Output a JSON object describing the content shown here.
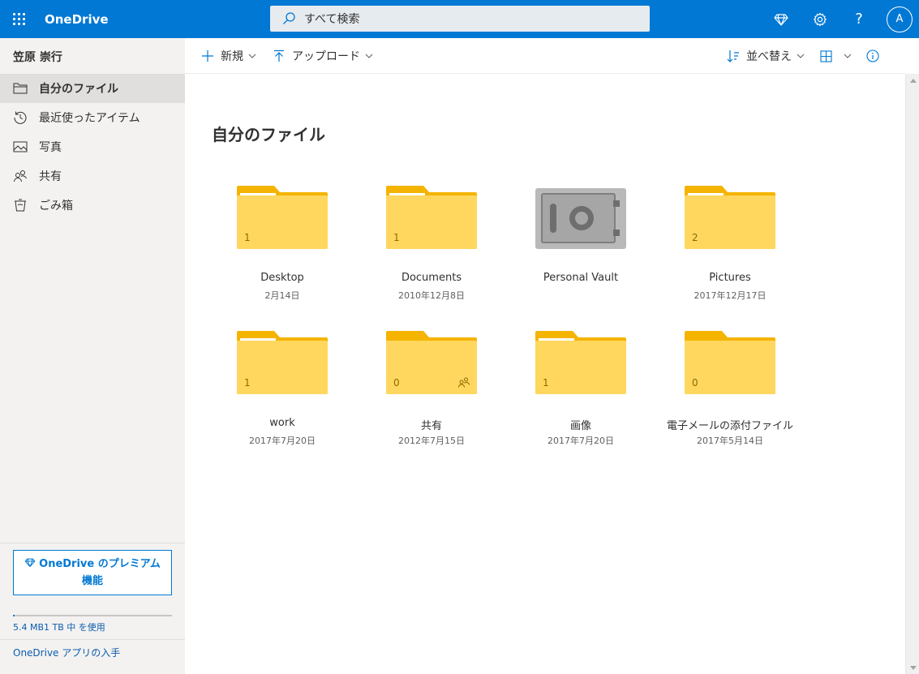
{
  "app": {
    "name": "OneDrive"
  },
  "search": {
    "placeholder": "すべて検索"
  },
  "user": {
    "name": "笠原 崇行",
    "initial": "A"
  },
  "sidebar": {
    "items": [
      {
        "label": "自分のファイル",
        "icon": "folder-icon",
        "active": true
      },
      {
        "label": "最近使ったアイテム",
        "icon": "history-icon",
        "active": false
      },
      {
        "label": "写真",
        "icon": "photo-icon",
        "active": false
      },
      {
        "label": "共有",
        "icon": "people-icon",
        "active": false
      },
      {
        "label": "ごみ箱",
        "icon": "trash-icon",
        "active": false
      }
    ],
    "premium_label": "OneDrive のプレミアム機能",
    "storage_text": "5.4 MB1 TB 中 を使用",
    "get_app": "OneDrive アプリの入手"
  },
  "commands": {
    "new_label": "新規",
    "upload_label": "アップロード",
    "sort_label": "並べ替え"
  },
  "main": {
    "title": "自分のファイル",
    "items": [
      {
        "name": "Desktop",
        "date": "2月14日",
        "count": "1",
        "type": "folder"
      },
      {
        "name": "Documents",
        "date": "2010年12月8日",
        "count": "1",
        "type": "folder"
      },
      {
        "name": "Personal Vault",
        "date": "",
        "count": "",
        "type": "vault"
      },
      {
        "name": "Pictures",
        "date": "2017年12月17日",
        "count": "2",
        "type": "folder"
      },
      {
        "name": "work",
        "date": "2017年7月20日",
        "count": "1",
        "type": "folder"
      },
      {
        "name": "共有",
        "date": "2012年7月15日",
        "count": "0",
        "type": "shared-folder"
      },
      {
        "name": "画像",
        "date": "2017年7月20日",
        "count": "1",
        "type": "folder"
      },
      {
        "name": "電子メールの添付ファイル",
        "date": "2017年5月14日",
        "count": "0",
        "type": "folder"
      }
    ]
  },
  "colors": {
    "brand": "#0078d4",
    "folder": "#ffd75e",
    "folder_tab": "#f5b400"
  }
}
